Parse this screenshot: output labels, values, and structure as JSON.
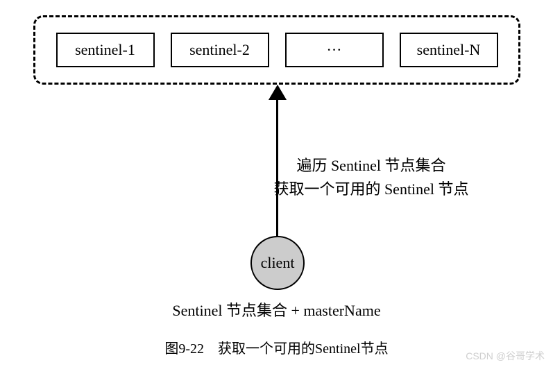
{
  "cluster": {
    "nodes": [
      "sentinel-1",
      "sentinel-2",
      "···",
      "sentinel-N"
    ]
  },
  "annotation": {
    "line1": "遍历 Sentinel 节点集合",
    "line2": "获取一个可用的 Sentinel 节点"
  },
  "client": {
    "label": "client"
  },
  "below_label": "Sentinel 节点集合 + masterName",
  "caption": "图9-22　获取一个可用的Sentinel节点",
  "watermark": "CSDN @谷哥学术"
}
